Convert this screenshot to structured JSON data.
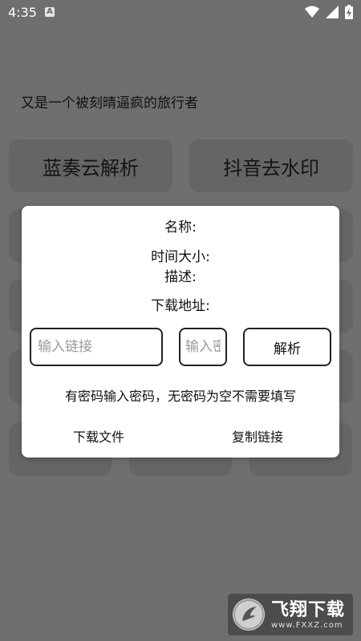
{
  "status": {
    "time": "4:35",
    "badge": "A"
  },
  "app": {
    "tagline": "又是一个被刻晴逼疯的旅行者"
  },
  "menu": {
    "btn1": "蓝奏云解析",
    "btn2": "抖音去水印"
  },
  "dialog": {
    "name_label": "名称:",
    "time_size_label": "时间大小:",
    "desc_label": "描述:",
    "download_url_label": "下载地址:",
    "link_placeholder": "输入链接",
    "password_placeholder": "输入密码",
    "parse_label": "解析",
    "hint": "有密码输入密码，无密码为空不需要填写",
    "download_file": "下载文件",
    "copy_link": "复制链接"
  },
  "watermark": {
    "cn": "飞翔下载",
    "url": "www.FXXZ.com"
  },
  "colors": {
    "overlay": "#6f6f6f",
    "dialog": "#ffffff",
    "border": "#222222"
  }
}
